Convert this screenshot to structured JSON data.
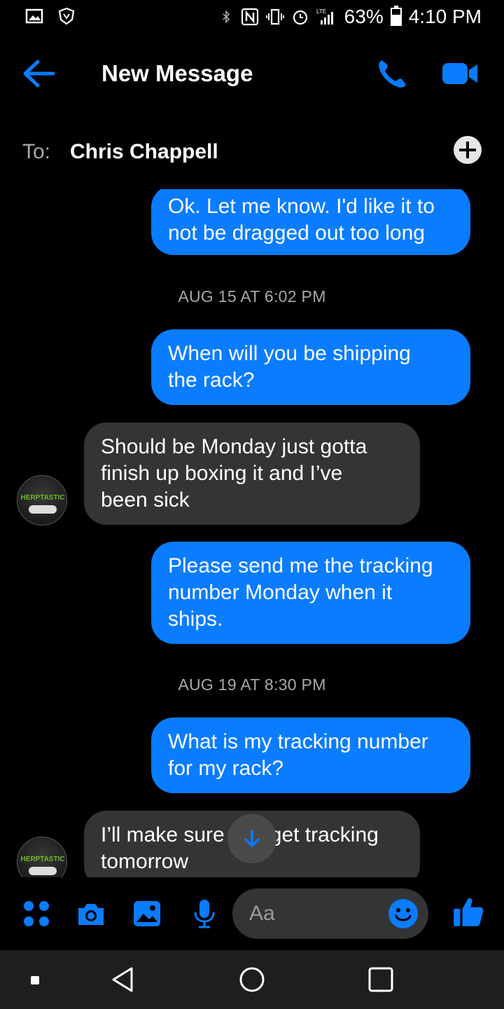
{
  "status_bar": {
    "battery_text": "63%",
    "battery_level": 0.63,
    "time": "4:10 PM",
    "network_label": "LTE",
    "icons": [
      "gallery-icon",
      "shield-icon",
      "bluetooth-icon",
      "nfc-icon",
      "vibrate-icon",
      "alarm-icon",
      "signal-icon",
      "battery-icon"
    ]
  },
  "header": {
    "title": "New Message",
    "back_icon": "back-arrow-icon",
    "call_icon": "phone-icon",
    "video_icon": "video-camera-icon"
  },
  "to_row": {
    "label": "To:",
    "recipient": "Chris Chappell",
    "add_icon": "plus-icon"
  },
  "messages": [
    {
      "type": "out",
      "text": "Ok. Let me know. I'd like it to\nnot be dragged out too long"
    },
    {
      "type": "timestamp",
      "text": "AUG 15 AT 6:02 PM"
    },
    {
      "type": "out",
      "text": "When will you be shipping\nthe rack?"
    },
    {
      "type": "in",
      "text": "Should be Monday just gotta\nfinish up boxing it and I’ve\nbeen sick"
    },
    {
      "type": "out",
      "text": "Please send me the tracking\nnumber Monday when it\nships."
    },
    {
      "type": "timestamp",
      "text": "AUG 19 AT 8:30 PM"
    },
    {
      "type": "out",
      "text": "What is my tracking number\nfor my rack?"
    },
    {
      "type": "in",
      "text": "I’ll make sure you get tracking\ntomorrow"
    }
  ],
  "avatar": {
    "text": "HERPTASTIC"
  },
  "composer": {
    "placeholder": "Aa",
    "icons": [
      "apps-icon",
      "camera-icon",
      "photo-icon",
      "microphone-icon",
      "emoji-icon",
      "thumbs-up-icon"
    ]
  },
  "colors": {
    "accent": "#0a7cff",
    "outgoing_bubble": "#0a7cff",
    "incoming_bubble": "#333436",
    "background": "#000000"
  },
  "nav": {
    "icons": [
      "recent-apps-dot-icon",
      "back-triangle-icon",
      "home-circle-icon",
      "overview-square-icon"
    ]
  }
}
